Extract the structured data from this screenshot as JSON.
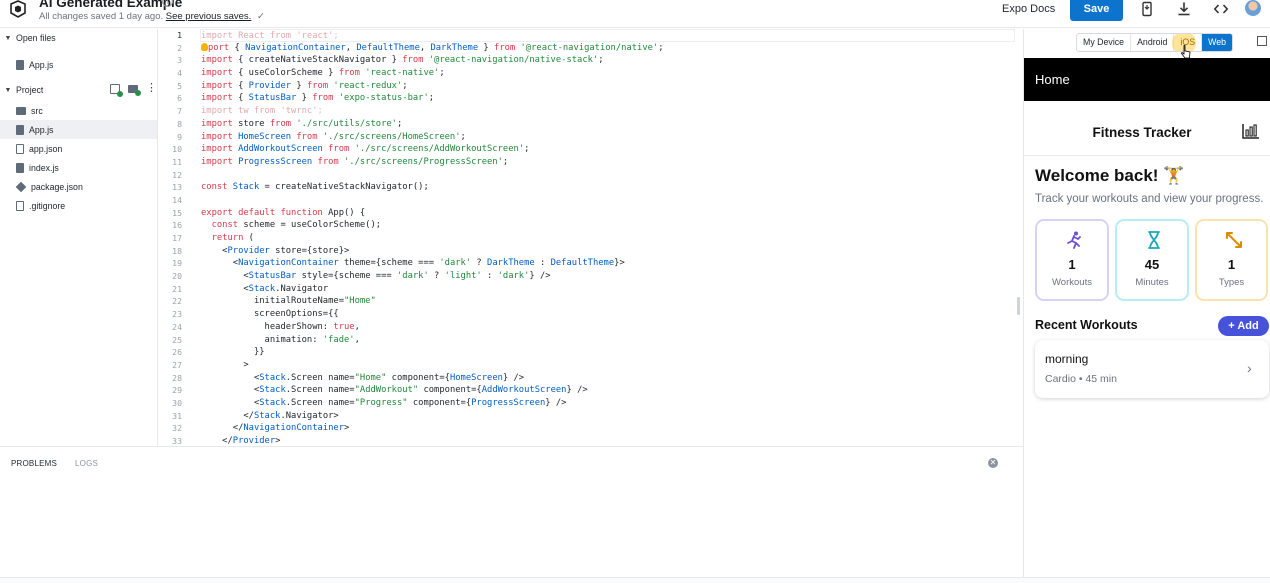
{
  "header": {
    "project_title": "AI Generated Example",
    "save_status": "All changes saved 1 day ago.",
    "previous_saves_link": "See previous saves.",
    "docs_link": "Expo Docs",
    "save_label": "Save",
    "icons": [
      "expo-logo-icon",
      "info-icon",
      "check-icon",
      "device-qr-icon",
      "download-icon",
      "code-embed-icon",
      "avatar"
    ]
  },
  "sidebar": {
    "open_files_label": "Open files",
    "open_files": [
      {
        "name": "App.js",
        "icon": "js-file-icon"
      }
    ],
    "project_label": "Project",
    "project_items": [
      {
        "name": "src",
        "icon": "folder-icon"
      },
      {
        "name": "App.js",
        "icon": "js-file-icon",
        "active": true
      },
      {
        "name": "app.json",
        "icon": "file-icon"
      },
      {
        "name": "index.js",
        "icon": "js-file-icon"
      },
      {
        "name": "package.json",
        "icon": "package-icon"
      },
      {
        "name": ".gitignore",
        "icon": "file-icon"
      }
    ]
  },
  "editor": {
    "current_line": 1,
    "lines": [
      "import React from 'react';",
      "import { NavigationContainer, DefaultTheme, DarkTheme } from '@react-navigation/native';",
      "import { createNativeStackNavigator } from '@react-navigation/native-stack';",
      "import { useColorScheme } from 'react-native';",
      "import { Provider } from 'react-redux';",
      "import { StatusBar } from 'expo-status-bar';",
      "import tw from 'twrnc';",
      "import store from './src/utils/store';",
      "import HomeScreen from './src/screens/HomeScreen';",
      "import AddWorkoutScreen from './src/screens/AddWorkoutScreen';",
      "import ProgressScreen from './src/screens/ProgressScreen';",
      "",
      "const Stack = createNativeStackNavigator();",
      "",
      "export default function App() {",
      "  const scheme = useColorScheme();",
      "  return (",
      "    <Provider store={store}>",
      "      <NavigationContainer theme={scheme === 'dark' ? DarkTheme : DefaultTheme}>",
      "        <StatusBar style={scheme === 'dark' ? 'light' : 'dark'} />",
      "        <Stack.Navigator",
      "          initialRouteName=\"Home\"",
      "          screenOptions={{",
      "            headerShown: true,",
      "            animation: 'fade',",
      "          }}",
      "        >",
      "          <Stack.Screen name=\"Home\" component={HomeScreen} />",
      "          <Stack.Screen name=\"AddWorkout\" component={AddWorkoutScreen} />",
      "          <Stack.Screen name=\"Progress\" component={ProgressScreen} />",
      "        </Stack.Navigator>",
      "      </NavigationContainer>",
      "    </Provider>"
    ]
  },
  "panel": {
    "tabs": [
      "PROBLEMS",
      "LOGS"
    ],
    "active_tab": "PROBLEMS"
  },
  "preview": {
    "platform_tabs": [
      "My Device",
      "Android",
      "iOS",
      "Web"
    ],
    "selected_platform": "Web",
    "hovered_platform": "iOS",
    "app": {
      "header_title": "Home",
      "title": "Fitness Tracker",
      "welcome": "Welcome back! 🏋️",
      "subtitle": "Track your workouts and view your progress.",
      "stats": [
        {
          "value": "1",
          "label": "Workouts",
          "icon": "running-icon",
          "color": "#6d4fd8"
        },
        {
          "value": "45",
          "label": "Minutes",
          "icon": "hourglass-icon",
          "color": "#1aa6b7"
        },
        {
          "value": "1",
          "label": "Types",
          "icon": "expand-arrows-icon",
          "color": "#e08a00"
        }
      ],
      "recent_title": "Recent Workouts",
      "add_label": "+ Add",
      "workouts": [
        {
          "name": "morning",
          "meta": "Cardio • 45 min"
        }
      ]
    }
  },
  "colors": {
    "accent": "#0d74ce",
    "add_button": "#4652d9",
    "app_header": "#000000"
  }
}
